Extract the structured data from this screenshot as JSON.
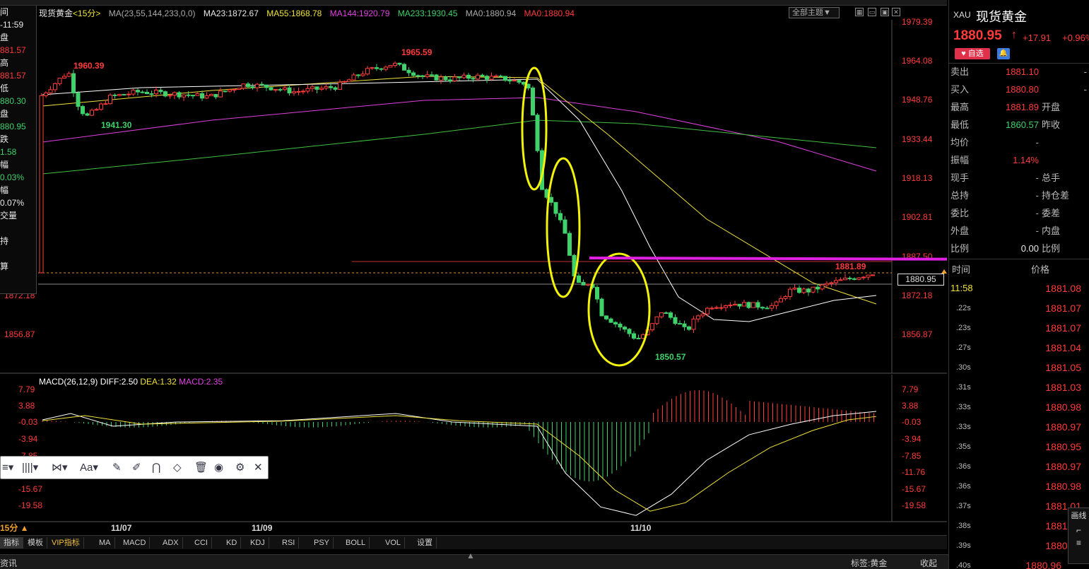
{
  "window": {
    "title": "现货黄金",
    "interval": "<15分>"
  },
  "indicators": {
    "ma_params": "MA(23,55,144,233,0,0)",
    "ma23": "MA23:1872.67",
    "ma55": "MA55:1868.78",
    "ma144": "MA144:1920.79",
    "ma233": "MA233:1930.45",
    "ma0a": "MA0:1880.94",
    "ma0b": "MA0:1880.94",
    "theme": "全部主题▼"
  },
  "left_panel": {
    "rows": [
      "间",
      "-11:59",
      "盘",
      "881.57",
      "高",
      "881.57",
      "低",
      "880.30",
      "盘",
      "880.95",
      "跌",
      "1.58",
      "幅",
      "0.03%",
      "幅",
      "0.07%",
      "交量",
      "",
      "持",
      "",
      "算"
    ]
  },
  "price_axis": {
    "labels": [
      "1979.39",
      "1964.08",
      "1948.76",
      "1933.44",
      "1918.13",
      "1902.81",
      "1887.50",
      "1872.18",
      "1856.87"
    ],
    "current": "1880.95"
  },
  "left_axis": {
    "labels": [
      "1872.18",
      "1856.87"
    ]
  },
  "annotations": {
    "high1": "1960.39",
    "low1": "1941.30",
    "high2": "1965.59",
    "low2": "1850.57",
    "recent_high": "1881.89"
  },
  "macd": {
    "title": "MACD(26,12,9)",
    "diff": "DIFF:2.50",
    "dea": "DEA:1.32",
    "macd": "MACD:2.35",
    "axis": [
      "7.79",
      "3.88",
      "-0.03",
      "-3.94",
      "-7.85",
      "-11.76",
      "-15.67",
      "-19.58"
    ]
  },
  "date_axis": {
    "d1": "11/07",
    "d2": "11/09",
    "d3": "11/10",
    "interval_label": "15分 ▲"
  },
  "bottom_tabs": [
    "指标",
    "模板",
    "VIP指标",
    "MA",
    "MACD",
    "ADX",
    "CCI",
    "KD",
    "KDJ",
    "RSI",
    "PSY",
    "BOLL",
    "VOL",
    "设置"
  ],
  "toolbar": {
    "items": [
      "≡▾",
      "||||▾",
      "⋈▾",
      "Aa▾",
      "✎",
      "✐",
      "⋂",
      "◇",
      "🗑",
      "◉",
      "⚙",
      "✕"
    ]
  },
  "status": {
    "left": "资讯",
    "right1": "标签:黄金",
    "right2": "收起"
  },
  "quote": {
    "symbol": "XAU",
    "name": "现货黄金",
    "price": "1880.95",
    "arrow": "↑",
    "change": "+17.91",
    "pct": "+0.96%",
    "fav": "♥ 自选",
    "rows": [
      {
        "l1": "卖出",
        "v1": "1881.10",
        "l2": "",
        "v2": "-",
        "c1": "red"
      },
      {
        "l1": "买入",
        "v1": "1880.80",
        "l2": "",
        "v2": "-",
        "c1": "red"
      },
      {
        "l1": "最高",
        "v1": "1881.89",
        "l2": "开盘",
        "v2": "",
        "c1": "red"
      },
      {
        "l1": "最低",
        "v1": "1860.57",
        "l2": "昨收",
        "v2": "",
        "c1": "green"
      },
      {
        "l1": "均价",
        "v1": "-",
        "l2": "",
        "v2": "",
        "c1": "grey"
      },
      {
        "l1": "振幅",
        "v1": "1.14%",
        "l2": "",
        "v2": "",
        "c1": "red"
      },
      {
        "l1": "现手",
        "v1": "-",
        "l2": "总手",
        "v2": "",
        "c1": "grey"
      },
      {
        "l1": "总持",
        "v1": "-",
        "l2": "持仓差",
        "v2": "",
        "c1": "grey"
      },
      {
        "l1": "委比",
        "v1": "-",
        "l2": "委差",
        "v2": "",
        "c1": "grey"
      },
      {
        "l1": "外盘",
        "v1": "-",
        "l2": "内盘",
        "v2": "",
        "c1": "grey"
      },
      {
        "l1": "比例",
        "v1": "0.00",
        "l2": "比例",
        "v2": "",
        "c1": "white"
      }
    ],
    "ticks_header": {
      "time": "时间",
      "price": "价格"
    },
    "ticks": [
      {
        "t": "11:58",
        "p": "1881.08"
      },
      {
        "t": ".22s",
        "p": "1881.07"
      },
      {
        "t": ".23s",
        "p": "1881.07"
      },
      {
        "t": ".27s",
        "p": "1881.04"
      },
      {
        "t": ".30s",
        "p": "1881.05"
      },
      {
        "t": ".31s",
        "p": "1881.03"
      },
      {
        "t": ".33s",
        "p": "1880.98"
      },
      {
        "t": ".33s",
        "p": "1880.97"
      },
      {
        "t": ".35s",
        "p": "1880.95"
      },
      {
        "t": ".36s",
        "p": "1880.97"
      },
      {
        "t": ".36s",
        "p": "1880.98"
      },
      {
        "t": ".37s",
        "p": "1881.01"
      },
      {
        "t": ".38s",
        "p": "1881.02"
      },
      {
        "t": ".39s",
        "p": "1880.95"
      },
      {
        "t": ".40s",
        "p": "1880.96"
      }
    ],
    "side_btn": "画线"
  },
  "colors": {
    "up": "#ff3b3b",
    "down": "#3fd16a",
    "ma23": "#ffffff",
    "ma55": "#f0e23a",
    "ma144": "#e040e0",
    "ma233": "#3fc13f",
    "highlight": "#e020e0",
    "circle": "#f2f20a"
  }
}
